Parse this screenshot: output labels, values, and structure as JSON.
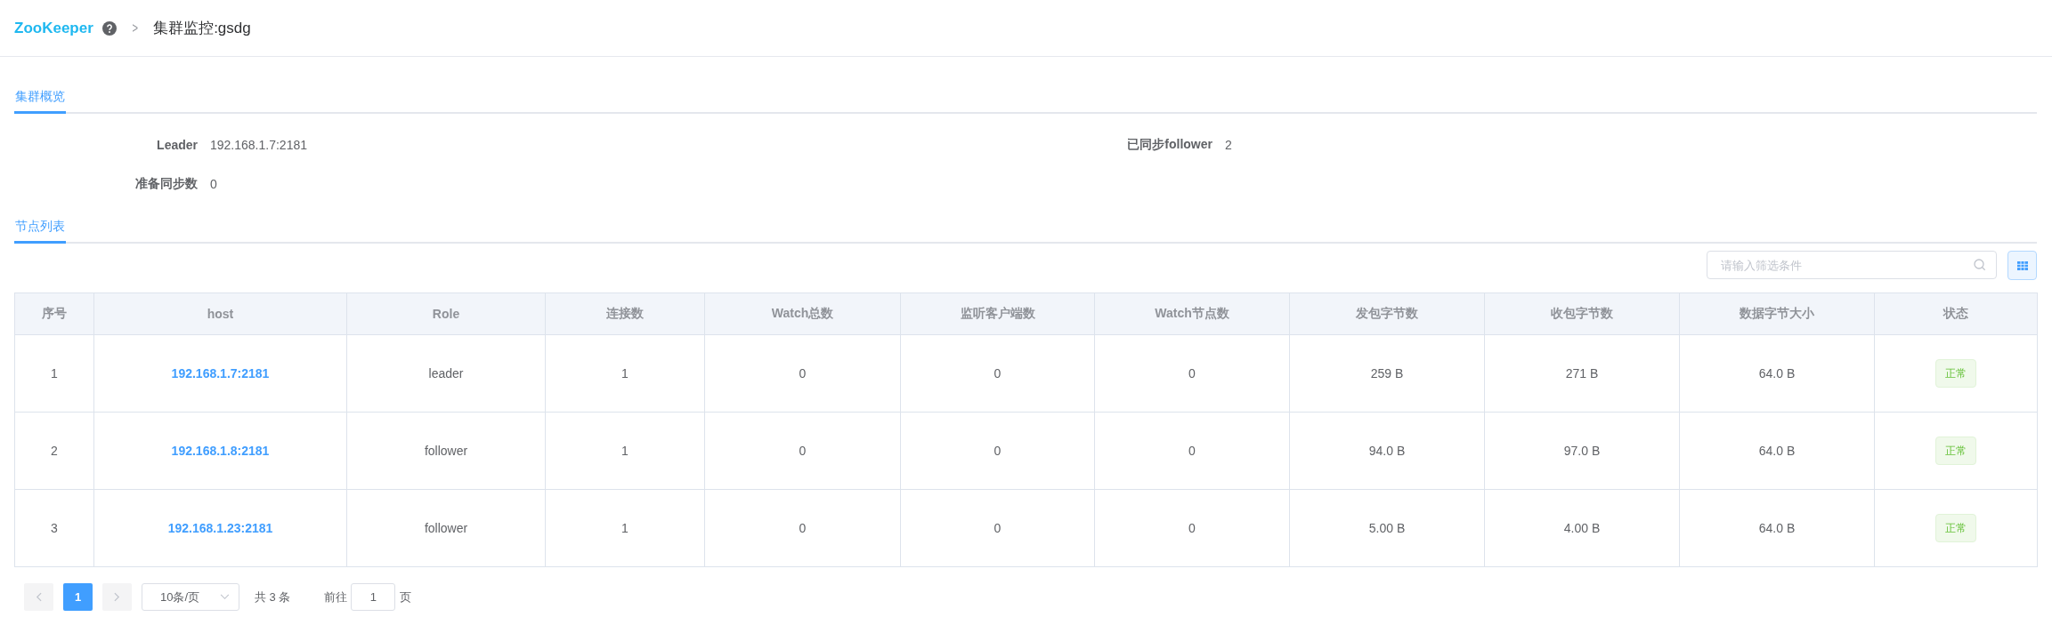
{
  "breadcrumb": {
    "brand": "ZooKeeper",
    "separator": ">",
    "current": "集群监控:gsdg"
  },
  "overview_tab": {
    "label": "集群概览",
    "selected": true
  },
  "overview": [
    {
      "label": "Leader",
      "value": "192.168.1.7:2181"
    },
    {
      "label": "已同步follower",
      "value": "2"
    },
    {
      "label": "准备同步数",
      "value": "0"
    }
  ],
  "nodes_tab": {
    "label": "节点列表",
    "selected": true
  },
  "search": {
    "placeholder": "请输入筛选条件"
  },
  "table": {
    "columns": [
      "序号",
      "host",
      "Role",
      "连接数",
      "Watch总数",
      "监听客户端数",
      "Watch节点数",
      "发包字节数",
      "收包字节数",
      "数据字节大小",
      "状态"
    ],
    "rows": [
      {
        "cells": [
          "1",
          "192.168.1.7:2181",
          "leader",
          "1",
          "0",
          "0",
          "0",
          "259 B",
          "271 B",
          "64.0 B"
        ],
        "status": {
          "label": "正常",
          "kind": "success"
        }
      },
      {
        "cells": [
          "2",
          "192.168.1.8:2181",
          "follower",
          "1",
          "0",
          "0",
          "0",
          "94.0 B",
          "97.0 B",
          "64.0 B"
        ],
        "status": {
          "label": "正常",
          "kind": "success"
        }
      },
      {
        "cells": [
          "3",
          "192.168.1.23:2181",
          "follower",
          "1",
          "0",
          "0",
          "0",
          "5.00 B",
          "4.00 B",
          "64.0 B"
        ],
        "status": {
          "label": "正常",
          "kind": "success"
        }
      }
    ]
  },
  "pagination": {
    "prev_disabled": true,
    "next_disabled": true,
    "pages": [
      {
        "label": "1",
        "selected": true
      }
    ],
    "page_size": "10条/页",
    "total": "共 3 条",
    "goto": "前往",
    "goto_value": "1",
    "goto_suffix": "页"
  }
}
